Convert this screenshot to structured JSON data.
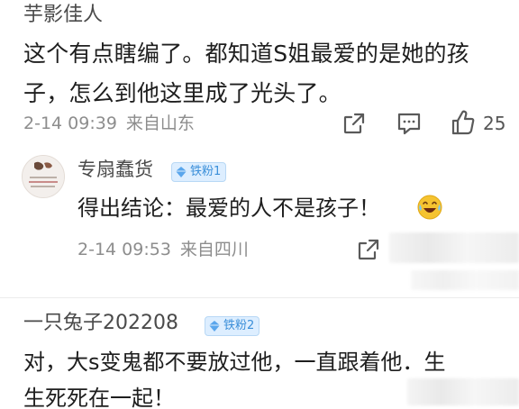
{
  "comment1": {
    "author": "芋影佳人",
    "text_lines": [
      "这个有点瞎编了。都知道S姐最爱的是她的孩",
      "子，怎么到他这里成了光头了。"
    ],
    "date": "2-14 09:39",
    "location": "来自山东",
    "like_count": "25",
    "icons": [
      "share-icon",
      "comment-icon",
      "like-icon"
    ]
  },
  "reply": {
    "author": "专扇蠢货",
    "badge": "铁粉1",
    "text": "得出结论：最爱的人不是孩子！",
    "emoji": "laugh-cry-emoji",
    "date": "2-14 09:53",
    "location": "来自四川",
    "icons": [
      "share-icon"
    ]
  },
  "comment2": {
    "author": "一只兔子202208",
    "badge": "铁粉2",
    "text_lines": [
      "对，大s变鬼都不要放过他，一直跟着他．生",
      "生死死在一起！"
    ]
  },
  "colors": {
    "text": "#1e1e1e",
    "meta": "#8d8d8d",
    "badge_bg": "#ddeeff",
    "badge_text": "#3b8fd9",
    "emoji": "#f5c330"
  }
}
